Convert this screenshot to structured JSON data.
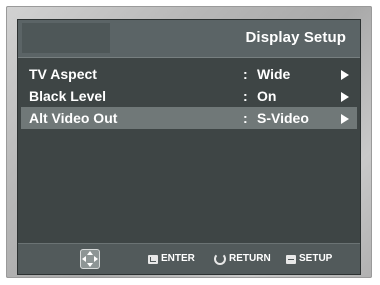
{
  "header": {
    "title": "Display Setup"
  },
  "menu": {
    "rows": [
      {
        "label": "TV Aspect",
        "separator": ":",
        "value": "Wide"
      },
      {
        "label": "Black Level",
        "separator": ":",
        "value": "On"
      },
      {
        "label": "Alt Video Out",
        "separator": ":",
        "value": "S-Video"
      }
    ],
    "selected_index": 2
  },
  "footer": {
    "nav_icon": "directional-pad-icon",
    "enter_label": "ENTER",
    "return_label": "RETURN",
    "setup_label": "SETUP"
  },
  "colors": {
    "screen_bg": "#3e4545",
    "header_bg": "#5b6466",
    "selected_row_bg": "#707878",
    "text": "#ffffff"
  }
}
